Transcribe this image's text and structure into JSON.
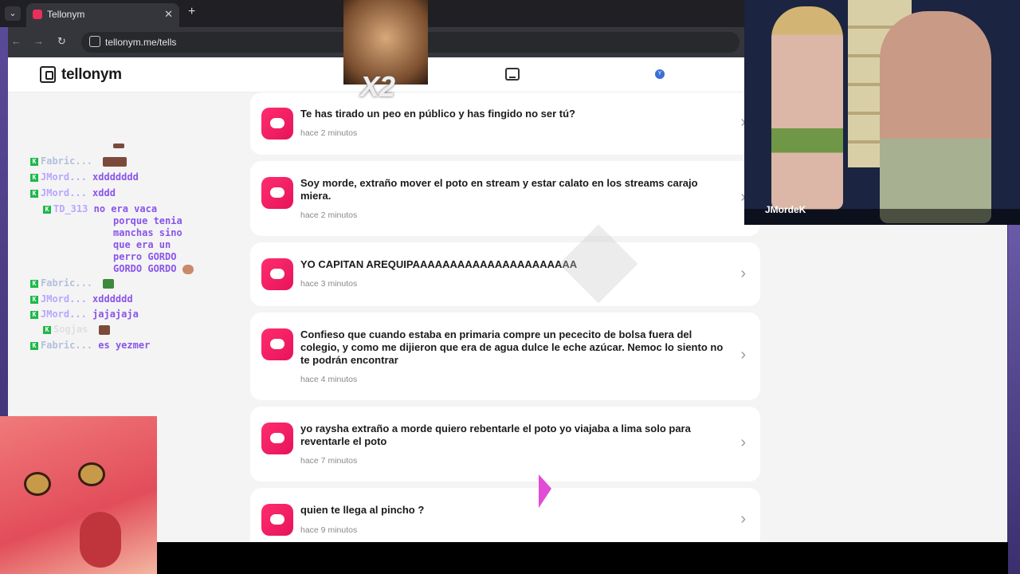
{
  "browser": {
    "tab_title": "Tellonym",
    "tab_close": "✕",
    "new_tab": "+",
    "url": "tellonym.me/tells",
    "back": "←",
    "forward": "→",
    "reload": "↻"
  },
  "app": {
    "brand": "tellonym",
    "avatar_initial": "Y"
  },
  "tells": [
    {
      "message": "Te has tirado un peo en público y has fingido no ser tú?",
      "time": "hace 2 minutos"
    },
    {
      "message": "Soy morde, extraño mover el poto en stream y estar calato en los streams carajo miera.",
      "time": "hace 2 minutos"
    },
    {
      "message": "YO CAPITAN AREQUIPAAAAAAAAAAAAAAAAAAAAAA",
      "time": "hace 3 minutos"
    },
    {
      "message": "Confieso que cuando estaba en primaria compre un pececito de bolsa fuera del colegio, y como me dijieron que era de agua dulce le eche azúcar. Nemoc lo siento no te podrán encontrar",
      "time": "hace 4 minutos"
    },
    {
      "message": "yo raysha extraño a morde quiero rebentarle el poto yo viajaba a lima solo para reventarle el poto",
      "time": "hace 7 minutos"
    },
    {
      "message": "quien te llega al pincho ?",
      "time": "hace 9 minutos"
    }
  ],
  "chat": [
    {
      "user": "Fabric...",
      "text": ""
    },
    {
      "user": "JMord...",
      "text": "xddddddd"
    },
    {
      "user": "JMord...",
      "text": "xddd"
    },
    {
      "user": "TD_313",
      "text": "no era vaca"
    },
    {
      "user": "",
      "text": "porque tenia"
    },
    {
      "user": "",
      "text": "manchas sino"
    },
    {
      "user": "",
      "text": "que era un"
    },
    {
      "user": "",
      "text": "perro GORDO"
    },
    {
      "user": "",
      "text": "GORDO GORDO"
    },
    {
      "user": "Fabric...",
      "text": ""
    },
    {
      "user": "JMord...",
      "text": "xdddddd"
    },
    {
      "user": "JMord...",
      "text": "jajajaja"
    },
    {
      "user": "Sogjas",
      "text": ""
    },
    {
      "user": "Fabric...",
      "text": "es yezmer"
    }
  ],
  "overlays": {
    "meme_text": "X2",
    "stream_name": "JMordeK",
    "chevron": "›",
    "mod_badge": "K"
  }
}
